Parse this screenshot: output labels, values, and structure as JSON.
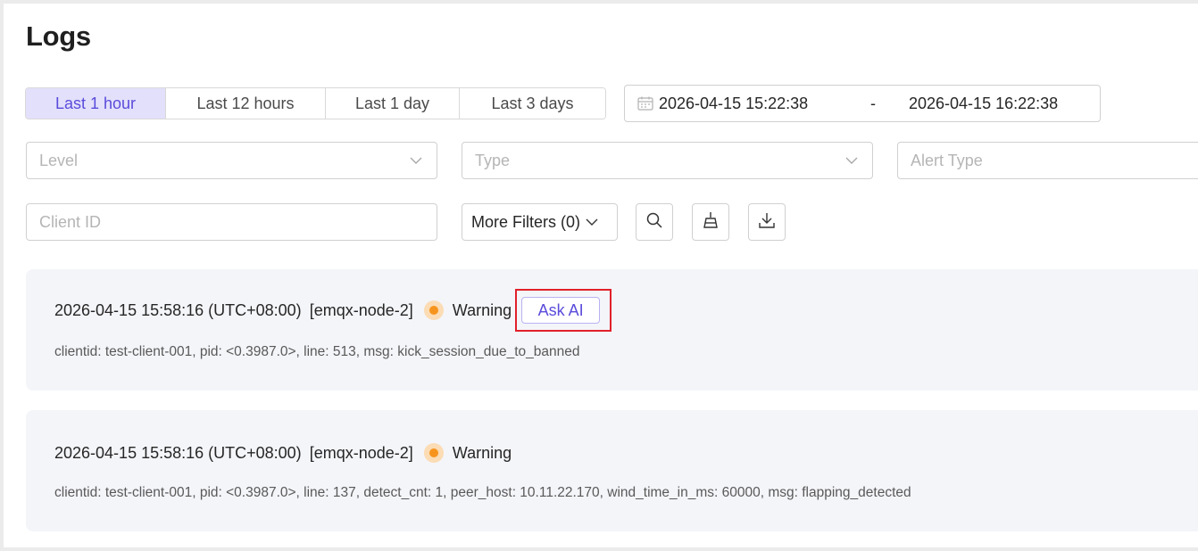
{
  "page": {
    "title": "Logs"
  },
  "time_ranges": [
    {
      "label": "Last 1 hour",
      "active": true
    },
    {
      "label": "Last 12 hours",
      "active": false
    },
    {
      "label": "Last 1 day",
      "active": false
    },
    {
      "label": "Last 3 days",
      "active": false
    }
  ],
  "date_range": {
    "start": "2026-04-15 15:22:38",
    "separator": "-",
    "end": "2026-04-15 16:22:38",
    "icon": "calendar-icon"
  },
  "filters": {
    "level_placeholder": "Level",
    "type_placeholder": "Type",
    "alert_type_placeholder": "Alert Type",
    "client_id_placeholder": "Client ID",
    "more_filters_label": "More Filters (0)"
  },
  "toolbar_icons": [
    "search-icon",
    "clear-icon",
    "download-icon"
  ],
  "logs": [
    {
      "timestamp": "2026-04-15 15:58:16 (UTC+08:00)",
      "node": "[emqx-node-2]",
      "level": "Warning",
      "ask_ai_label": "Ask AI",
      "message": "clientid: test-client-001, pid: <0.3987.0>, line: 513, msg: kick_session_due_to_banned"
    },
    {
      "timestamp": "2026-04-15 15:58:16 (UTC+08:00)",
      "node": "[emqx-node-2]",
      "level": "Warning",
      "message": "clientid: test-client-001, pid: <0.3987.0>, line: 137, detect_cnt: 1, peer_host: 10.11.22.170, wind_time_in_ms: 60000, msg: flapping_detected"
    }
  ],
  "colors": {
    "accent": "#5a4cdb",
    "active_tab_bg": "#e3e0fb",
    "warning_dot": "#f7941d",
    "highlight_box": "#e0202a",
    "card_bg": "#f4f5f9"
  }
}
